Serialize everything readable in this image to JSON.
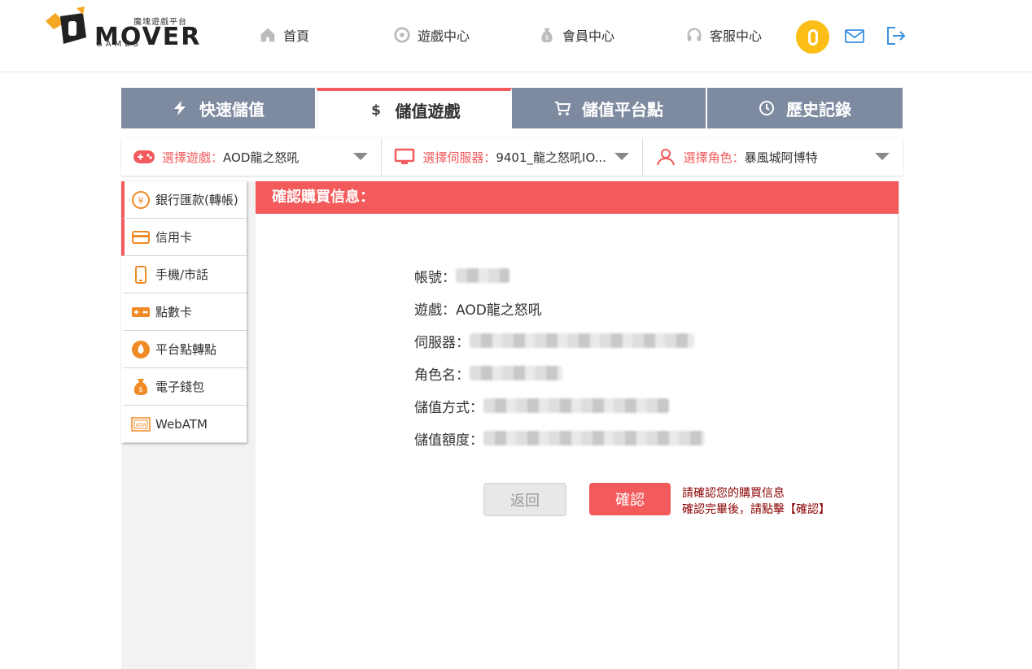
{
  "header": {
    "logo": {
      "subtitle": "魔塊遊戲平台",
      "wordmark": "MOVER",
      "games": "GAMES"
    },
    "nav": [
      {
        "label": "首頁",
        "icon": "home-icon"
      },
      {
        "label": "遊戲中心",
        "icon": "gamepad-icon"
      },
      {
        "label": "會員中心",
        "icon": "money-bag-icon"
      },
      {
        "label": "客服中心",
        "icon": "headset-icon"
      }
    ],
    "coin_glyph": "0",
    "accent_color": "#fbbd16"
  },
  "tabs": [
    {
      "label": "快速儲值",
      "icon": "lightning-icon"
    },
    {
      "label": "儲值遊戲",
      "icon": "dollar-icon",
      "active": true
    },
    {
      "label": "儲值平台點",
      "icon": "cart-icon"
    },
    {
      "label": "歷史記錄",
      "icon": "clock-icon"
    }
  ],
  "selectors": [
    {
      "label": "選擇遊戲：",
      "value": "AOD龍之怒吼",
      "icon": "gamepad-icon"
    },
    {
      "label": "選擇伺服器：",
      "value": "9401_龍之怒吼IO...",
      "icon": "monitor-icon"
    },
    {
      "label": "選擇角色：",
      "value": "暴風城阿博特",
      "icon": "user-icon"
    }
  ],
  "sidebar": {
    "items": [
      {
        "label": "銀行匯款(轉帳)",
        "icon": "yuan-icon",
        "active": true
      },
      {
        "label": "信用卡",
        "icon": "credit-card-icon",
        "active": true
      },
      {
        "label": "手機/市話",
        "icon": "phone-icon"
      },
      {
        "label": "點數卡",
        "icon": "point-card-icon"
      },
      {
        "label": "平台點轉點",
        "icon": "drop-icon"
      },
      {
        "label": "電子錢包",
        "icon": "wallet-bag-icon"
      },
      {
        "label": "WebATM",
        "icon": "atm-icon"
      }
    ]
  },
  "confirm": {
    "title": "確認購買信息：",
    "rows": [
      {
        "label": "帳號：",
        "value": ""
      },
      {
        "label": "遊戲：",
        "value": "AOD龍之怒吼"
      },
      {
        "label": "伺服器：",
        "value": ""
      },
      {
        "label": "角色名：",
        "value": ""
      },
      {
        "label": "儲值方式：",
        "value": ""
      },
      {
        "label": "儲值額度：",
        "value": ""
      }
    ],
    "back_label": "返回",
    "ok_label": "確認",
    "note_line1": "請確認您的購買信息",
    "note_line2": "確認完畢後，請點擊【確認】"
  },
  "colors": {
    "primary": "#f25a5b",
    "tab_bg": "#7d8aa0"
  }
}
